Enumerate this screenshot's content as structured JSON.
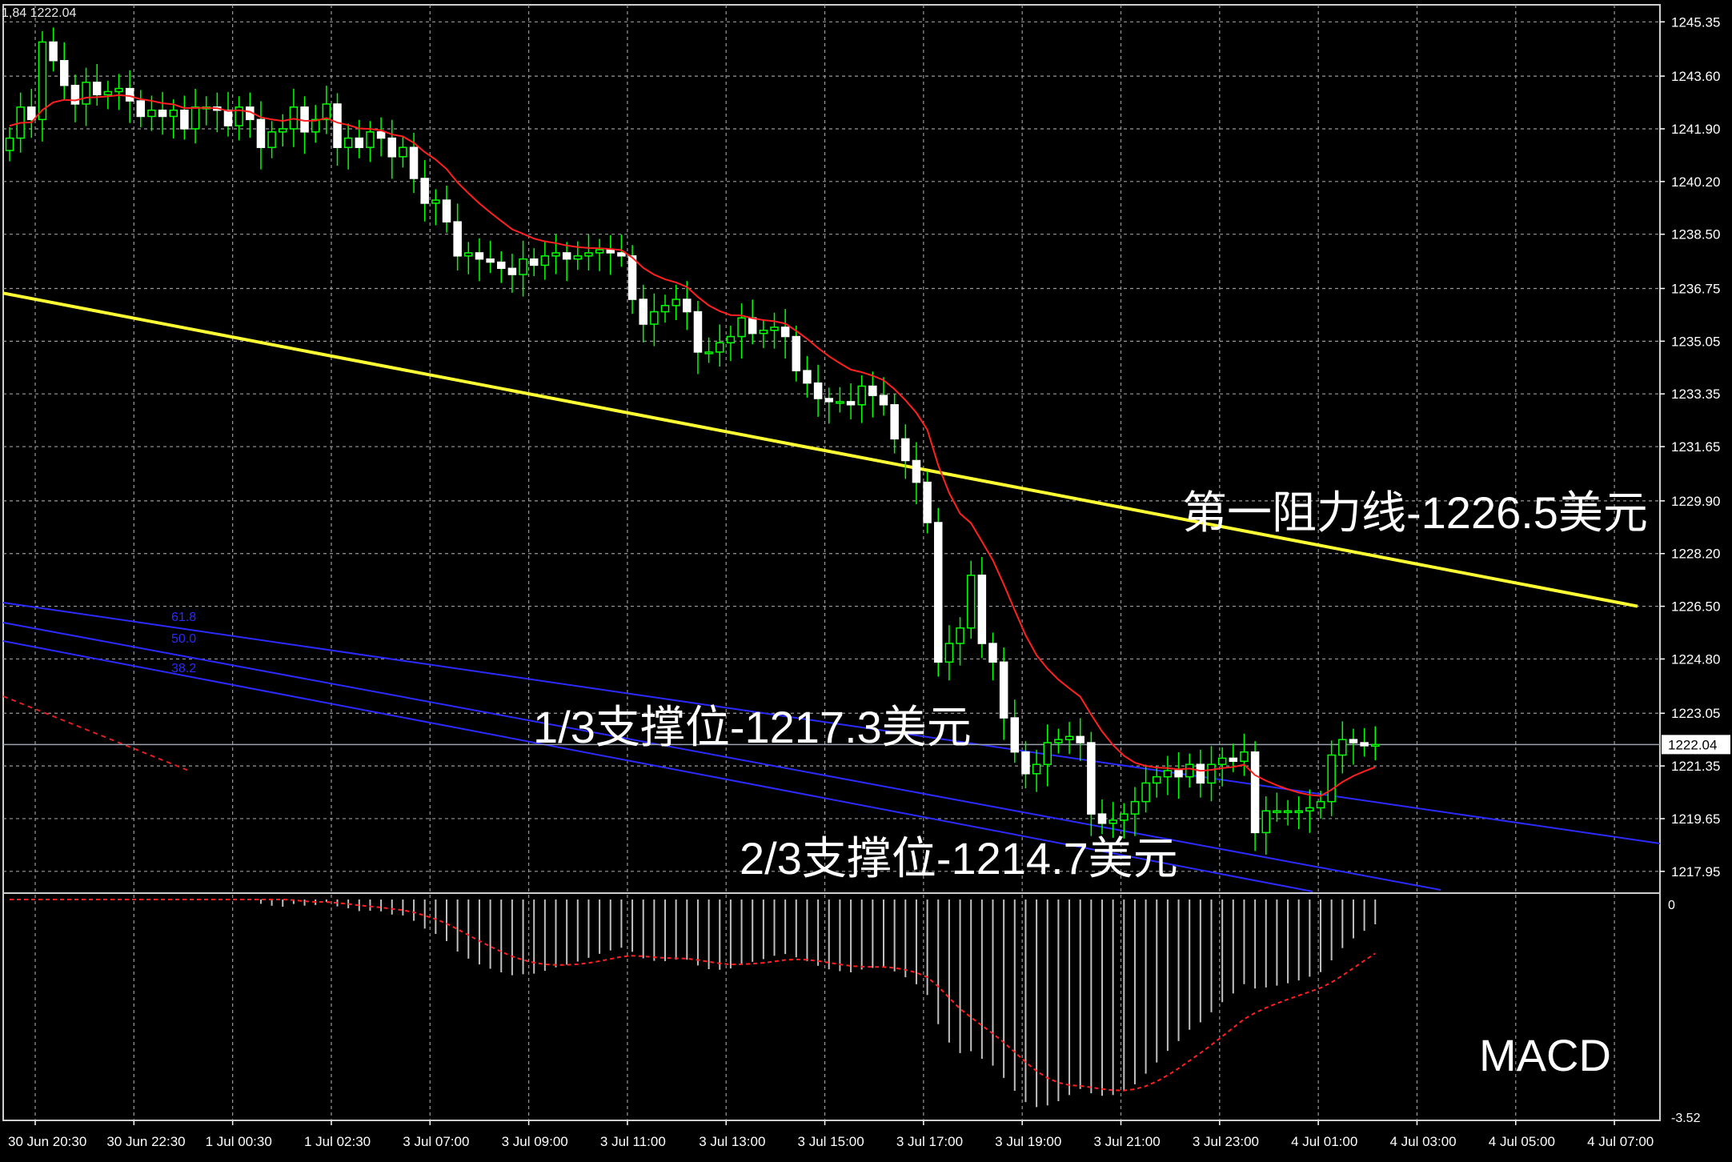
{
  "header": {
    "info": "1,84 1222.04"
  },
  "annotations": {
    "resistance": "第一阻力线-1226.5美元",
    "support_1_3": "1/3支撑位-1217.3美元",
    "support_2_3": "2/3支撑位-1214.7美元",
    "macd": "MACD"
  },
  "colors": {
    "bull": "#00ff00",
    "ma": "#ff2020",
    "trendline": "#ffff33",
    "fib": "#2b2bff",
    "grid": "#9a9a9a",
    "macd_bar": "#c0c0c0",
    "macd_signal": "#ff2020",
    "current_price_line": "#9aa4b0"
  },
  "chart_data": {
    "type": "candlestick",
    "title": "",
    "ylim": [
      1217.3,
      1245.9
    ],
    "y_ticks": [
      "1245.35",
      "1243.60",
      "1241.90",
      "1240.20",
      "1238.50",
      "1236.75",
      "1235.05",
      "1233.35",
      "1231.65",
      "1229.90",
      "1228.20",
      "1226.50",
      "1224.80",
      "1223.05",
      "1221.35",
      "1219.65",
      "1217.95"
    ],
    "current_price": "1222.04",
    "x_ticks": [
      "30 Jun 20:30",
      "30 Jun 22:30",
      "1 Jul 00:30",
      "1 Jul 02:30",
      "3 Jul 07:00",
      "3 Jul 09:00",
      "3 Jul 11:00",
      "3 Jul 13:00",
      "3 Jul 15:00",
      "3 Jul 17:00",
      "3 Jul 19:00",
      "3 Jul 21:00",
      "3 Jul 23:00",
      "4 Jul 01:00",
      "4 Jul 03:00",
      "4 Jul 05:00",
      "4 Jul 07:00"
    ],
    "closes": [
      1241.6,
      1242.6,
      1242.2,
      1244.7,
      1244.1,
      1243.3,
      1242.7,
      1243.4,
      1243.0,
      1243.1,
      1243.2,
      1242.8,
      1242.3,
      1242.5,
      1242.3,
      1242.5,
      1241.9,
      1242.6,
      1242.6,
      1242.5,
      1242.0,
      1242.6,
      1242.2,
      1241.3,
      1241.8,
      1241.9,
      1242.6,
      1241.8,
      1242.2,
      1242.7,
      1241.3,
      1241.6,
      1241.3,
      1241.8,
      1241.6,
      1241.0,
      1241.3,
      1240.3,
      1239.5,
      1239.6,
      1238.9,
      1237.8,
      1237.9,
      1237.7,
      1237.6,
      1237.4,
      1237.2,
      1237.7,
      1237.5,
      1237.8,
      1237.9,
      1237.7,
      1237.8,
      1237.9,
      1238.0,
      1237.9,
      1237.8,
      1236.4,
      1235.6,
      1236.0,
      1236.2,
      1236.4,
      1236.0,
      1234.7,
      1234.7,
      1235.0,
      1235.2,
      1235.8,
      1235.3,
      1235.4,
      1235.5,
      1235.2,
      1234.1,
      1233.7,
      1233.2,
      1233.1,
      1233.1,
      1233.0,
      1233.6,
      1233.3,
      1233.0,
      1231.9,
      1231.2,
      1230.5,
      1229.2,
      1224.7,
      1225.3,
      1225.8,
      1227.5,
      1225.3,
      1224.7,
      1222.9,
      1221.8,
      1221.1,
      1221.4,
      1222.1,
      1222.2,
      1222.3,
      1222.1,
      1219.8,
      1219.5,
      1219.6,
      1219.8,
      1220.2,
      1220.8,
      1221.0,
      1221.2,
      1221.0,
      1221.4,
      1220.8,
      1221.4,
      1221.6,
      1221.5,
      1221.8,
      1219.2,
      1219.9,
      1219.9,
      1219.9,
      1219.9,
      1220.0,
      1220.2,
      1221.7,
      1222.2,
      1222.1,
      1222.0,
      1222.04
    ],
    "ma_last": 1221.5,
    "trendline": {
      "from": 1236.6,
      "to": 1226.5
    },
    "fib_levels": [
      "61.8",
      "50.0",
      "38.2"
    ],
    "macd": {
      "zero": "0",
      "min": "-3.52"
    }
  }
}
